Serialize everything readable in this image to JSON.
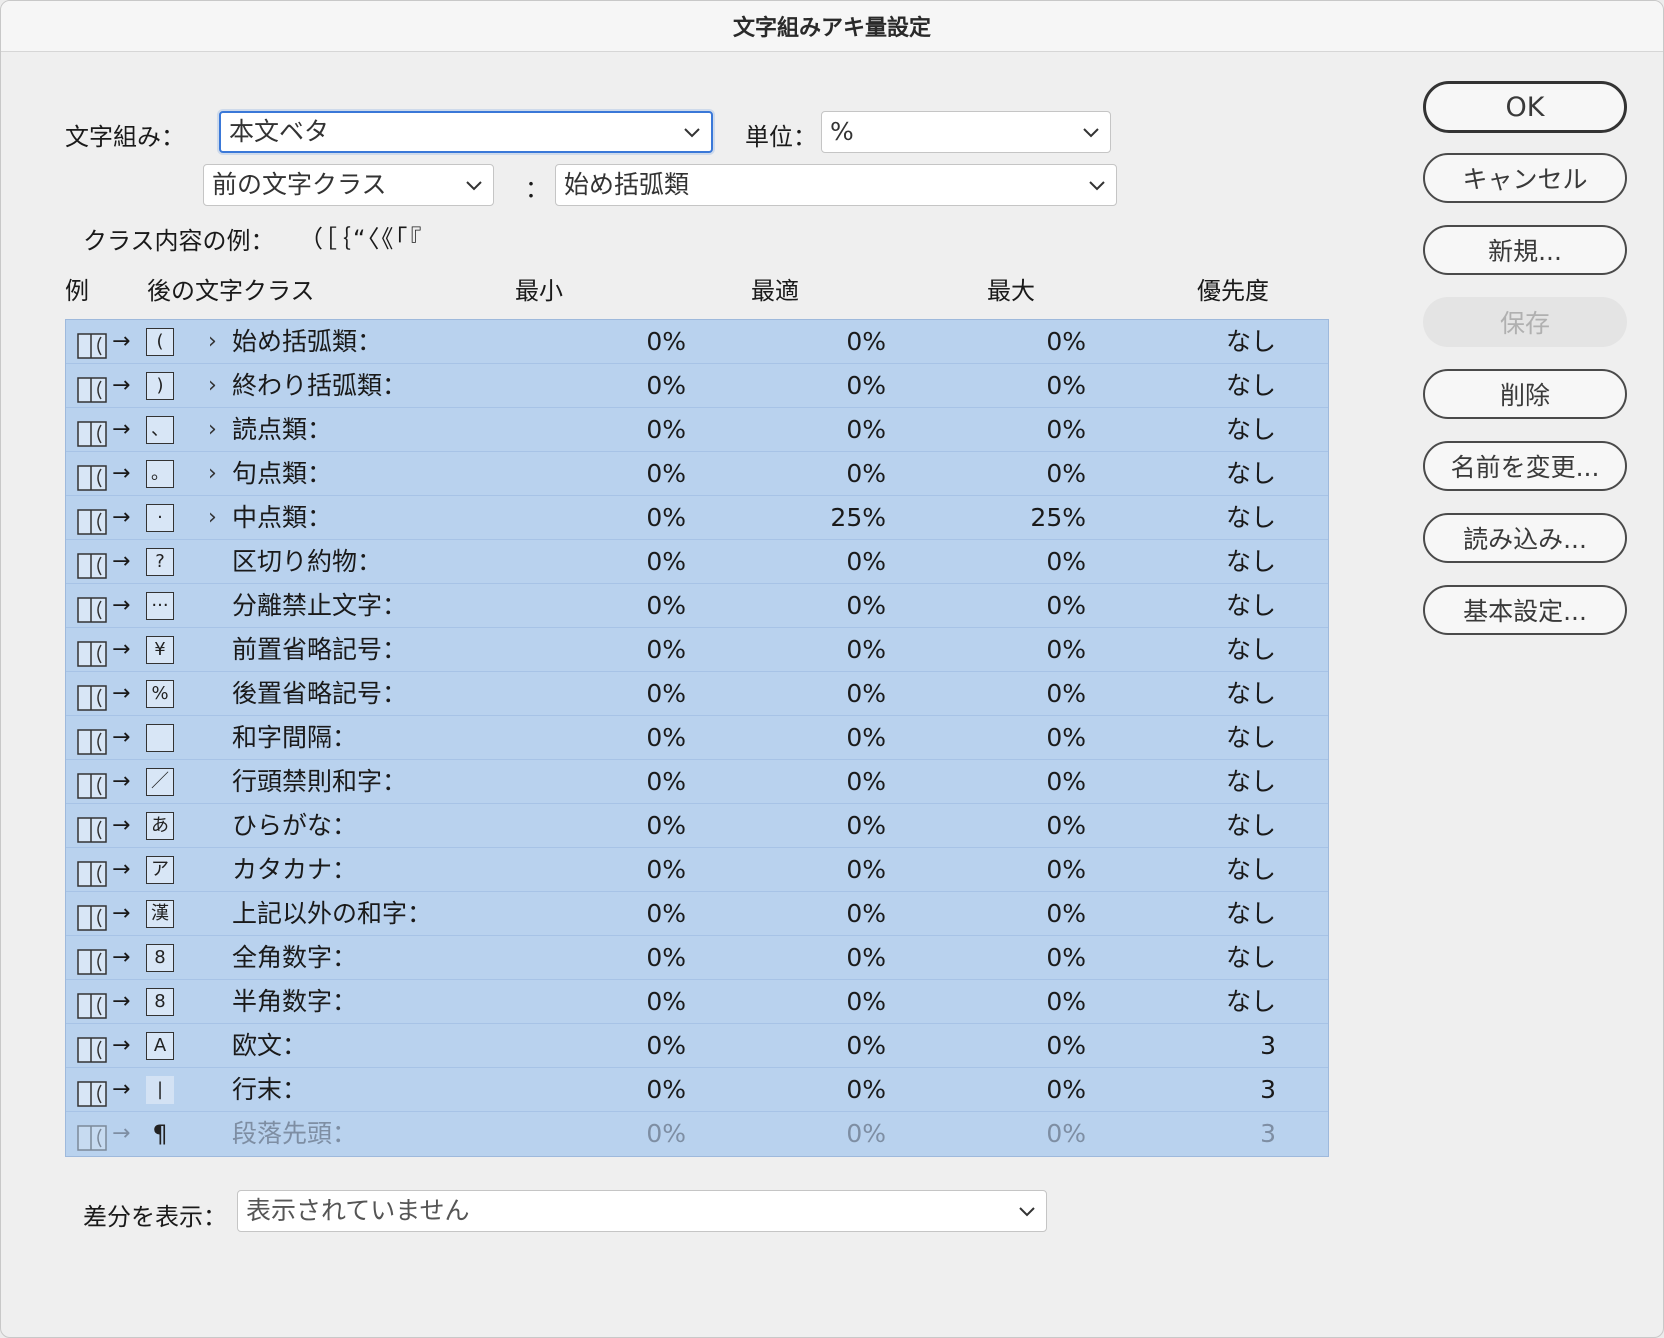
{
  "window": {
    "title": "文字組みアキ量設定"
  },
  "form": {
    "mojikumi_label": "文字組み：",
    "mojikumi_value": "本文ベタ",
    "unit_label": "単位：",
    "unit_value": "%",
    "class_select_value": "前の文字クラス",
    "colon": "：",
    "class_value": "始め括弧類",
    "example_label": "クラス内容の例：",
    "example_chars": "（［｛“〈《「『"
  },
  "columns": {
    "example": "例",
    "after_class": "後の文字クラス",
    "min": "最小",
    "optimal": "最適",
    "max": "最大",
    "priority": "優先度"
  },
  "rows": [
    {
      "glyph": "(",
      "expandable": true,
      "name": "始め括弧類：",
      "min": "0%",
      "opt": "0%",
      "max": "0%",
      "pri": "なし"
    },
    {
      "glyph": ")",
      "expandable": true,
      "name": "終わり括弧類：",
      "min": "0%",
      "opt": "0%",
      "max": "0%",
      "pri": "なし"
    },
    {
      "glyph": "、",
      "expandable": true,
      "name": "読点類：",
      "min": "0%",
      "opt": "0%",
      "max": "0%",
      "pri": "なし"
    },
    {
      "glyph": "。",
      "expandable": true,
      "name": "句点類：",
      "min": "0%",
      "opt": "0%",
      "max": "0%",
      "pri": "なし"
    },
    {
      "glyph": "·",
      "expandable": true,
      "name": "中点類：",
      "min": "0%",
      "opt": "25%",
      "max": "25%",
      "pri": "なし"
    },
    {
      "glyph": "?",
      "expandable": false,
      "name": "区切り約物：",
      "min": "0%",
      "opt": "0%",
      "max": "0%",
      "pri": "なし"
    },
    {
      "glyph": "···",
      "expandable": false,
      "name": "分離禁止文字：",
      "min": "0%",
      "opt": "0%",
      "max": "0%",
      "pri": "なし"
    },
    {
      "glyph": "¥",
      "expandable": false,
      "name": "前置省略記号：",
      "min": "0%",
      "opt": "0%",
      "max": "0%",
      "pri": "なし"
    },
    {
      "glyph": "%",
      "expandable": false,
      "name": "後置省略記号：",
      "min": "0%",
      "opt": "0%",
      "max": "0%",
      "pri": "なし"
    },
    {
      "glyph": "",
      "expandable": false,
      "name": "和字間隔：",
      "min": "0%",
      "opt": "0%",
      "max": "0%",
      "pri": "なし"
    },
    {
      "glyph": "／",
      "expandable": false,
      "name": "行頭禁則和字：",
      "min": "0%",
      "opt": "0%",
      "max": "0%",
      "pri": "なし"
    },
    {
      "glyph": "あ",
      "expandable": false,
      "name": "ひらがな：",
      "min": "0%",
      "opt": "0%",
      "max": "0%",
      "pri": "なし"
    },
    {
      "glyph": "ア",
      "expandable": false,
      "name": "カタカナ：",
      "min": "0%",
      "opt": "0%",
      "max": "0%",
      "pri": "なし"
    },
    {
      "glyph": "漢",
      "expandable": false,
      "name": "上記以外の和字：",
      "min": "0%",
      "opt": "0%",
      "max": "0%",
      "pri": "なし"
    },
    {
      "glyph": "8",
      "expandable": false,
      "name": "全角数字：",
      "min": "0%",
      "opt": "0%",
      "max": "0%",
      "pri": "なし"
    },
    {
      "glyph": "8",
      "expandable": false,
      "name": "半角数字：",
      "min": "0%",
      "opt": "0%",
      "max": "0%",
      "pri": "なし"
    },
    {
      "glyph": "A",
      "expandable": false,
      "name": "欧文：",
      "min": "0%",
      "opt": "0%",
      "max": "0%",
      "pri": "3"
    },
    {
      "glyph": "|",
      "expandable": false,
      "name": "行末：",
      "min": "0%",
      "opt": "0%",
      "max": "0%",
      "pri": "3"
    },
    {
      "glyph": "¶",
      "expandable": false,
      "name": "段落先頭：",
      "min": "0%",
      "opt": "0%",
      "max": "0%",
      "pri": "3",
      "dim": true
    }
  ],
  "footer": {
    "diff_label": "差分を表示：",
    "diff_value": "表示されていません"
  },
  "buttons": {
    "ok": "OK",
    "cancel": "キャンセル",
    "new": "新規...",
    "save": "保存",
    "delete": "削除",
    "rename": "名前を変更...",
    "import": "読み込み...",
    "basic": "基本設定..."
  }
}
